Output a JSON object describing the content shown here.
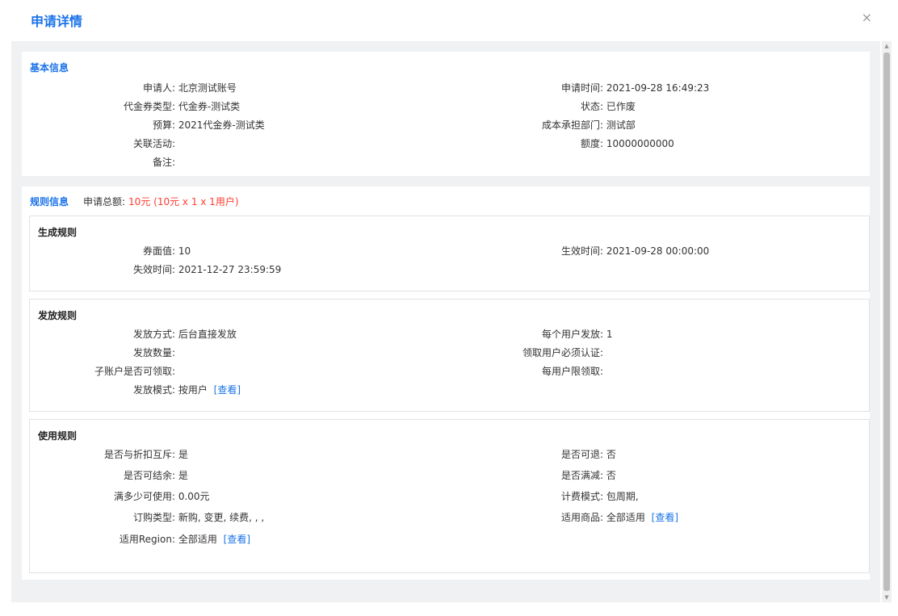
{
  "dialog": {
    "title": "申请详情",
    "close_glyph": "×"
  },
  "basic": {
    "title": "基本信息",
    "fields": {
      "applicant": {
        "label": "申请人:",
        "value": "北京测试账号"
      },
      "apply_time": {
        "label": "申请时间:",
        "value": "2021-09-28 16:49:23"
      },
      "coupon_type": {
        "label": "代金券类型:",
        "value": "代金券-测试类"
      },
      "status": {
        "label": "状态:",
        "value": "已作废"
      },
      "budget": {
        "label": "预算:",
        "value": "2021代金券-测试类"
      },
      "cost_dept": {
        "label": "成本承担部门:",
        "value": "测试部"
      },
      "activity": {
        "label": "关联活动:",
        "value": ""
      },
      "amount": {
        "label": "额度:",
        "value": "10000000000"
      },
      "remark": {
        "label": "备注:",
        "value": ""
      }
    }
  },
  "rules": {
    "title": "规则信息",
    "total_label": "申请总额:",
    "total_value": "10元 (10元 x 1 x 1用户)",
    "generate": {
      "title": "生成规则",
      "face_value": {
        "label": "券面值:",
        "value": "10"
      },
      "effective_time": {
        "label": "生效时间:",
        "value": "2021-09-28 00:00:00"
      },
      "expire_time": {
        "label": "失效时间:",
        "value": "2021-12-27 23:59:59"
      }
    },
    "issue": {
      "title": "发放规则",
      "method": {
        "label": "发放方式:",
        "value": "后台直接发放"
      },
      "per_user": {
        "label": "每个用户发放:",
        "value": "1"
      },
      "quantity": {
        "label": "发放数量:",
        "value": ""
      },
      "must_verify": {
        "label": "领取用户必须认证:",
        "value": ""
      },
      "sub_account": {
        "label": "子账户是否可领取:",
        "value": ""
      },
      "limit_per_user": {
        "label": "每用户限领取:",
        "value": ""
      },
      "mode": {
        "label": "发放模式:",
        "value": "按用户",
        "link": "[查看]"
      }
    },
    "usage": {
      "title": "使用规则",
      "exclusive_discount": {
        "label": "是否与折扣互斥:",
        "value": "是"
      },
      "refundable": {
        "label": "是否可退:",
        "value": "否"
      },
      "balance": {
        "label": "是否可结余:",
        "value": "是"
      },
      "full_reduce": {
        "label": "是否满减:",
        "value": "否"
      },
      "min_amount": {
        "label": "满多少可使用:",
        "value": "0.00元"
      },
      "billing_mode": {
        "label": "计费模式:",
        "value": "包周期,"
      },
      "order_type": {
        "label": "订购类型:",
        "value": "新购, 变更, 续费, , ,"
      },
      "products": {
        "label": "适用商品:",
        "value": "全部适用",
        "link": "[查看]"
      },
      "region": {
        "label": "适用Region:",
        "value": "全部适用",
        "link": "[查看]"
      }
    }
  }
}
